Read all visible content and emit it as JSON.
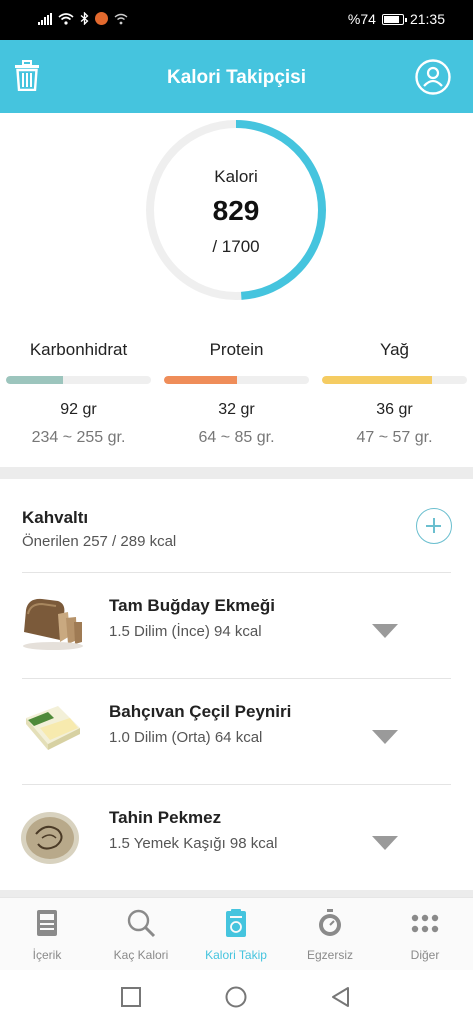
{
  "status": {
    "battery": "%74",
    "time": "21:35"
  },
  "header": {
    "title": "Kalori Takipçisi"
  },
  "calories": {
    "label": "Kalori",
    "value": "829",
    "goal": "/ 1700",
    "progress": 0.49,
    "accent": "#45c4de"
  },
  "macros": [
    {
      "name": "Karbonhidrat",
      "amount": "92 gr",
      "range": "234 ~ 255 gr.",
      "progress": 0.39,
      "color": "#9cc5bd"
    },
    {
      "name": "Protein",
      "amount": "32 gr",
      "range": "64 ~ 85 gr.",
      "progress": 0.5,
      "color": "#ef8d59"
    },
    {
      "name": "Yağ",
      "amount": "36 gr",
      "range": "47 ~ 57 gr.",
      "progress": 0.76,
      "color": "#f5cc62"
    }
  ],
  "meal": {
    "title": "Kahvaltı",
    "subtitle": "Önerilen 257 / 289 kcal",
    "items": [
      {
        "name": "Tam Buğday Ekmeği",
        "detail": "1.5 Dilim (İnce) 94 kcal",
        "icon": "bread-image"
      },
      {
        "name": "Bahçıvan Çeçil Peyniri",
        "detail": "1.0 Dilim (Orta) 64 kcal",
        "icon": "cheese-image"
      },
      {
        "name": "Tahin Pekmez",
        "detail": "1.5 Yemek Kaşığı 98 kcal",
        "icon": "tahini-image"
      }
    ]
  },
  "nav": [
    {
      "label": "İçerik",
      "icon": "document-icon",
      "active": false
    },
    {
      "label": "Kaç Kalori",
      "icon": "search-icon",
      "active": false
    },
    {
      "label": "Kalori Takip",
      "icon": "clipboard-icon",
      "active": true
    },
    {
      "label": "Egzersiz",
      "icon": "stopwatch-icon",
      "active": false
    },
    {
      "label": "Diğer",
      "icon": "grid-icon",
      "active": false
    }
  ]
}
